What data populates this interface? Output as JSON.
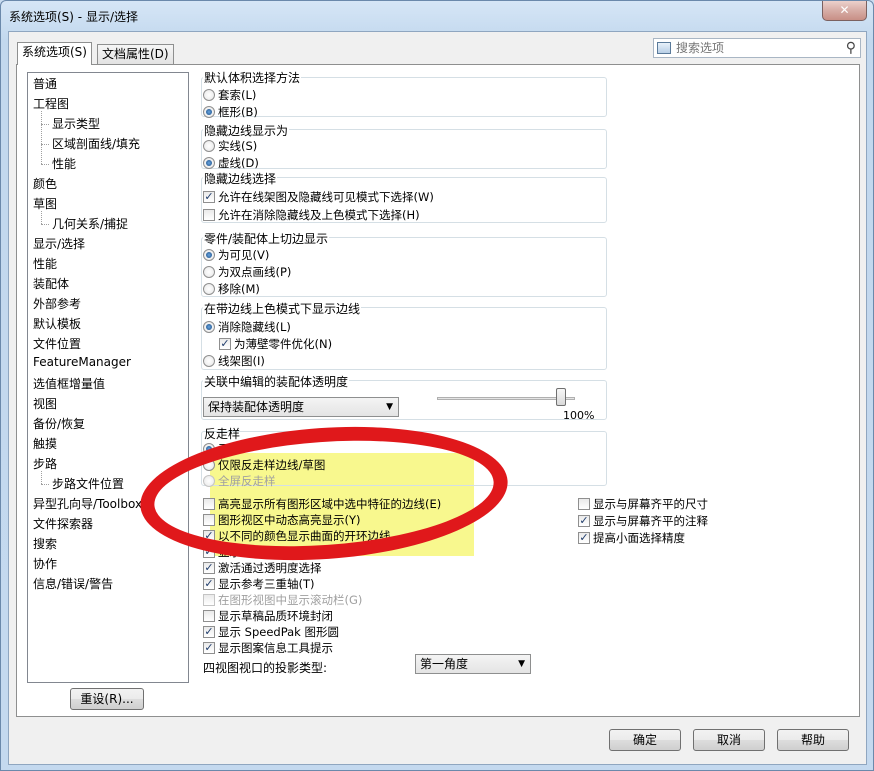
{
  "window": {
    "title": "系统选项(S) - 显示/选择",
    "close_glyph": "✕"
  },
  "tabs": [
    {
      "label": "系统选项(S)"
    },
    {
      "label": "文档属性(D)"
    }
  ],
  "search": {
    "placeholder": "搜索选项",
    "value": ""
  },
  "tree": {
    "items": [
      "普通",
      "工程图",
      "显示类型",
      "区域剖面线/填充",
      "性能",
      "颜色",
      "草图",
      "几何关系/捕捉",
      "显示/选择",
      "性能",
      "装配体",
      "外部参考",
      "默认模板",
      "文件位置",
      "FeatureManager",
      "选值框增量值",
      "视图",
      "备份/恢复",
      "触摸",
      "步路",
      "步路文件位置",
      "异型孔向导/Toolbox",
      "文件探索器",
      "搜索",
      "协作",
      "信息/错误/警告"
    ],
    "selected": "显示/选择"
  },
  "reset_button": "重设(R)...",
  "groups": {
    "box_select": {
      "title": "默认体积选择方法",
      "options": [
        "套索(L)",
        "框形(B)"
      ],
      "selected": 1
    },
    "hidden_display": {
      "title": "隐藏边线显示为",
      "options": [
        "实线(S)",
        "虚线(D)"
      ],
      "selected": 1
    },
    "hidden_select": {
      "title": "隐藏边线选择",
      "options": [
        {
          "label": "允许在线架图及隐藏线可见模式下选择(W)",
          "checked": true
        },
        {
          "label": "允许在消除隐藏线及上色模式下选择(H)",
          "checked": false
        }
      ]
    },
    "tangent": {
      "title": "零件/装配体上切边显示",
      "options": [
        "为可见(V)",
        "为双点画线(P)",
        "移除(M)"
      ],
      "selected": 0
    },
    "shaded_edges": {
      "title": "在带边线上色模式下显示边线",
      "option1": "消除隐藏线(L)",
      "sub_check": "为薄壁零件优化(N)",
      "sub_checked": true,
      "option2": "线架图(I)"
    },
    "transparency": {
      "title": "关联中编辑的装配体透明度",
      "combo": "保持装配体透明度",
      "slider_label": "100%",
      "slider_value": 0.9
    },
    "antialias": {
      "title": "反走样",
      "options": [
        "无",
        "仅限反走样边线/草图",
        "全屏反走样"
      ],
      "selected": 0
    }
  },
  "left_checks": [
    {
      "label": "高亮显示所有图形区域中选中特征的边线(E)",
      "checked": false,
      "disabled": false
    },
    {
      "label": "图形视区中动态高亮显示(Y)",
      "checked": false,
      "disabled": false
    },
    {
      "label": "以不同的颜色显示曲面的开环边线",
      "checked": true,
      "disabled": false
    },
    {
      "label": "显示上色基准面(A)",
      "checked": true,
      "disabled": false
    },
    {
      "label": "激活通过透明度选择",
      "checked": true,
      "disabled": false
    },
    {
      "label": "显示参考三重轴(T)",
      "checked": true,
      "disabled": false
    },
    {
      "label": "在图形视图中显示滚动栏(G)",
      "checked": false,
      "disabled": true
    },
    {
      "label": "显示草稿品质环境封闭",
      "checked": false,
      "disabled": false
    },
    {
      "label": "显示 SpeedPak 图形圆",
      "checked": true,
      "disabled": false
    },
    {
      "label": "显示图案信息工具提示",
      "checked": true,
      "disabled": false
    }
  ],
  "right_checks": [
    {
      "label": "显示与屏幕齐平的尺寸",
      "checked": false
    },
    {
      "label": "显示与屏幕齐平的注释",
      "checked": true
    },
    {
      "label": "提高小面选择精度",
      "checked": true
    }
  ],
  "projection": {
    "label": "四视图视口的投影类型:",
    "value": "第一角度"
  },
  "footer": {
    "ok": "确定",
    "cancel": "取消",
    "help": "帮助"
  },
  "annotation": {
    "highlight_color": "#f7f77a",
    "ellipse_color": "#e0181b"
  }
}
